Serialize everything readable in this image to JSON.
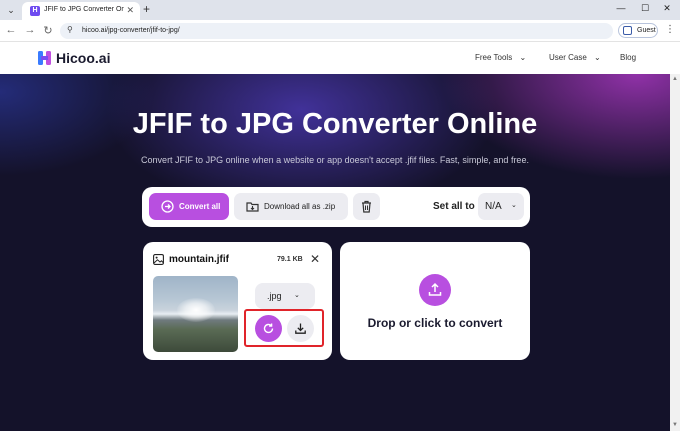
{
  "browser": {
    "tab_menu_icon": "⌄",
    "tab_title": "JFIF to JPG Converter Online - F",
    "tab_close": "✕",
    "new_tab": "+",
    "window": {
      "minimize": "—",
      "maximize": "☐",
      "close": "✕"
    },
    "nav": {
      "back": "←",
      "forward": "→",
      "reload": "↻"
    },
    "site_icon": "⚲",
    "url": "hicoo.ai/jpg-converter/jfif-to-jpg/",
    "profile_label": "Guest",
    "menu_icon": "⋮"
  },
  "site": {
    "logo": "Hicoo.ai",
    "nav": [
      {
        "label": "Free Tools",
        "chevron": "⌄"
      },
      {
        "label": "User Case",
        "chevron": "⌄"
      },
      {
        "label": "Blog"
      }
    ]
  },
  "hero": {
    "title": "JFIF to JPG Converter Online",
    "subtitle": "Convert JFIF to JPG online when a website or app doesn't accept .jfif files. Fast, simple, and free."
  },
  "actions": {
    "convert_all": "Convert all",
    "download_zip": "Download all as .zip",
    "set_all_label": "Set all to",
    "set_all_value": "N/A",
    "chevron": "⌄"
  },
  "file": {
    "name": "mountain.jfif",
    "size": "79.1 KB",
    "close": "✕",
    "format": ".jpg",
    "chevron": "⌄"
  },
  "dropzone": {
    "label": "Drop or click to convert"
  },
  "scrollbar": {
    "up": "▲",
    "down": "▼"
  },
  "colors": {
    "accent": "#b84fe0",
    "highlight": "#e0242a",
    "hero_bg": "#14122a"
  }
}
